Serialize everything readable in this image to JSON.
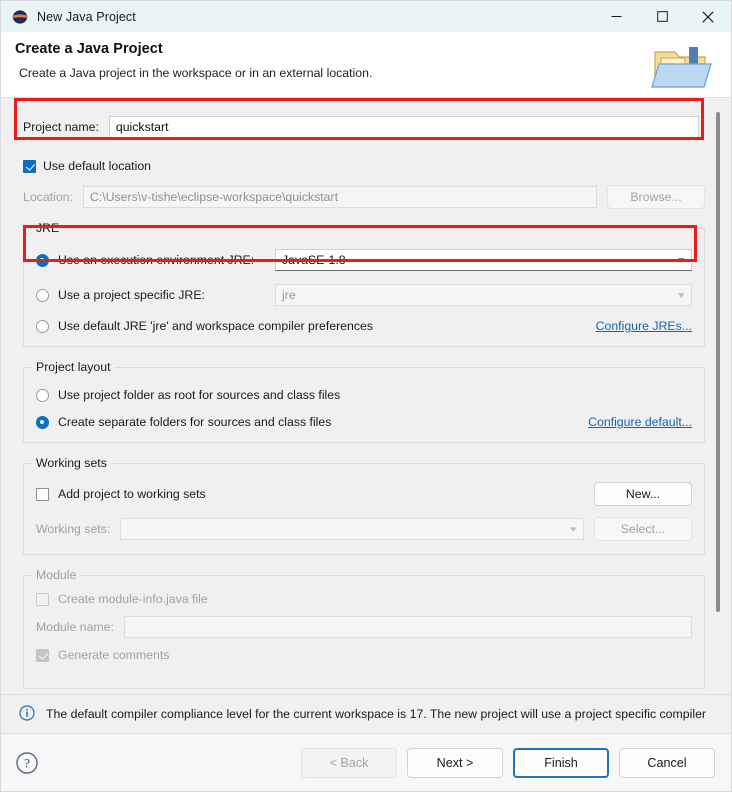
{
  "window": {
    "title": "New Java Project",
    "app_icon": "eclipse-icon",
    "controls": {
      "minimize": "minimize-icon",
      "maximize": "maximize-icon",
      "close": "close-icon"
    }
  },
  "header": {
    "title": "Create a Java Project",
    "subtitle": "Create a Java project in the workspace or in an external location.",
    "icon": "java-project-folder-icon"
  },
  "project_name": {
    "label": "Project name:",
    "value": "quickstart",
    "highlighted": true
  },
  "location": {
    "use_default_label": "Use default location",
    "use_default_checked": true,
    "label": "Location:",
    "value": "C:\\Users\\v-tishe\\eclipse-workspace\\quickstart",
    "browse_label": "Browse...",
    "browse_enabled": false
  },
  "jre": {
    "group_title": "JRE",
    "options": [
      {
        "label": "Use an execution environment JRE:",
        "selected": true,
        "control": "combo",
        "value": "JavaSE-1.8",
        "enabled": true,
        "highlighted": true
      },
      {
        "label": "Use a project specific JRE:",
        "selected": false,
        "control": "combo",
        "value": "jre",
        "enabled": false,
        "highlighted": false
      },
      {
        "label": "Use default JRE 'jre' and workspace compiler preferences",
        "selected": false,
        "control": "none",
        "value": "",
        "enabled": true,
        "highlighted": false
      }
    ],
    "configure_link": "Configure JREs..."
  },
  "project_layout": {
    "group_title": "Project layout",
    "options": [
      {
        "label": "Use project folder as root for sources and class files",
        "selected": false
      },
      {
        "label": "Create separate folders for sources and class files",
        "selected": true
      }
    ],
    "configure_link": "Configure default..."
  },
  "working_sets": {
    "group_title": "Working sets",
    "add_label": "Add project to working sets",
    "add_checked": false,
    "new_label": "New...",
    "sets_label": "Working sets:",
    "sets_value": "",
    "select_label": "Select..."
  },
  "module": {
    "group_title": "Module",
    "create_label": "Create module-info.java file",
    "create_checked": false,
    "name_label": "Module name:",
    "name_value": "",
    "generate_comments_label": "Generate comments",
    "generate_comments_checked": true,
    "enabled": false
  },
  "status": {
    "icon": "info-icon",
    "message": "The default compiler compliance level for the current workspace is 17. The new project will use a project specific compiler"
  },
  "footer": {
    "help_icon": "help-icon",
    "back_label": "< Back",
    "back_enabled": false,
    "next_label": "Next >",
    "finish_label": "Finish",
    "finish_is_default": true,
    "cancel_label": "Cancel"
  },
  "colors": {
    "highlight": "#ec1c1c",
    "accent": "#0b6fc4",
    "link": "#1464b4",
    "titlebar_bg": "#e9f5f5",
    "dialog_bg": "#f0f0f0"
  }
}
